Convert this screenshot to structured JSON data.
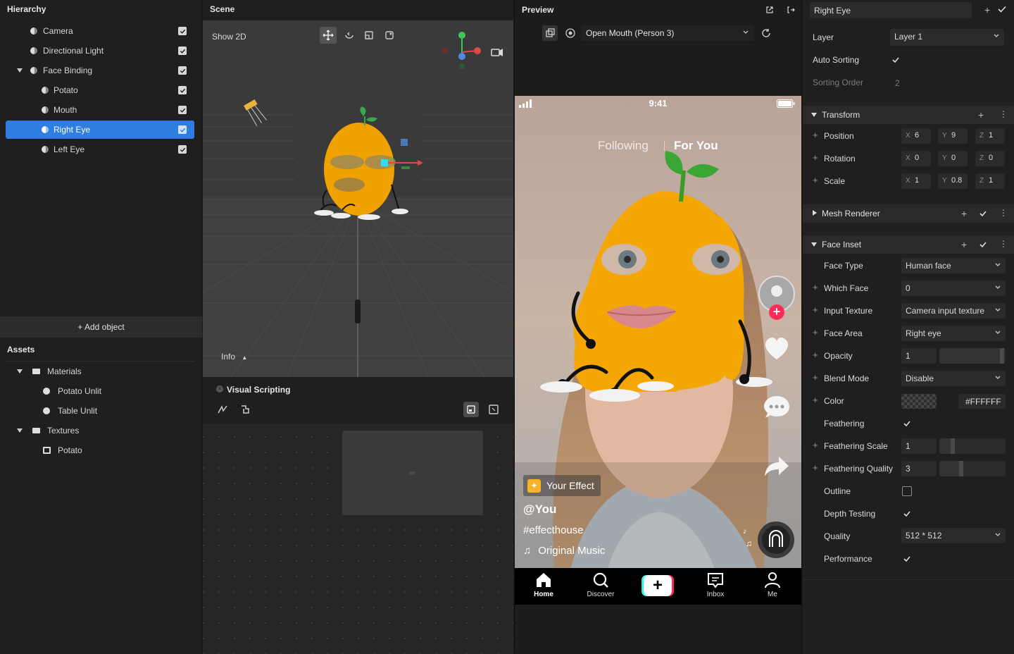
{
  "hierarchy": {
    "title": "Hierarchy",
    "items": [
      {
        "label": "Camera",
        "selected": false
      },
      {
        "label": "Directional Light",
        "selected": false
      },
      {
        "label": "Face Binding",
        "selected": false
      },
      {
        "label": "Potato",
        "selected": false
      },
      {
        "label": "Mouth",
        "selected": false
      },
      {
        "label": "Right Eye",
        "selected": true
      },
      {
        "label": "Left Eye",
        "selected": false
      }
    ],
    "add_object": "+ Add object"
  },
  "assets": {
    "title": "Assets",
    "items": [
      {
        "label": "Materials"
      },
      {
        "label": "Potato Unlit"
      },
      {
        "label": "Table Unlit"
      },
      {
        "label": "Textures"
      },
      {
        "label": "Potato"
      }
    ]
  },
  "scene": {
    "title": "Scene",
    "show2d": "Show 2D",
    "info": "Info"
  },
  "visual_scripting": {
    "title": "Visual Scripting"
  },
  "preview": {
    "title": "Preview",
    "trigger": "Open Mouth (Person 3)",
    "phone": {
      "time": "9:41",
      "following": "Following",
      "for_you": "For You",
      "effect_badge": "Your Effect",
      "user": "@You",
      "hashtag": "#effecthouse",
      "music": "Original Music",
      "nav": [
        "Home",
        "Discover",
        "Inbox",
        "Me"
      ]
    }
  },
  "inspector": {
    "object_name": "Right Eye",
    "layer_label": "Layer",
    "layer_value": "Layer 1",
    "auto_sorting": "Auto Sorting",
    "sorting_order": "Sorting Order",
    "sorting_order_value": "2",
    "transform": {
      "title": "Transform",
      "position": {
        "label": "Position",
        "x": "6",
        "y": "9",
        "z": "1"
      },
      "rotation": {
        "label": "Rotation",
        "x": "0",
        "y": "0",
        "z": "0"
      },
      "scale": {
        "label": "Scale",
        "x": "1",
        "y": "0.8",
        "z": "1"
      }
    },
    "mesh_renderer": "Mesh Renderer",
    "face_inset": {
      "title": "Face Inset",
      "face_type": {
        "label": "Face Type",
        "value": "Human face"
      },
      "which_face": {
        "label": "Which Face",
        "value": "0"
      },
      "input_texture": {
        "label": "Input Texture",
        "value": "Camera input texture"
      },
      "face_area": {
        "label": "Face Area",
        "value": "Right eye"
      },
      "opacity": {
        "label": "Opacity",
        "value": "1"
      },
      "blend_mode": {
        "label": "Blend Mode",
        "value": "Disable"
      },
      "color": {
        "label": "Color",
        "value": "#FFFFFF"
      },
      "feathering": "Feathering",
      "feathering_scale": {
        "label": "Feathering Scale",
        "value": "1"
      },
      "feathering_quality": {
        "label": "Feathering Quality",
        "value": "3"
      },
      "outline": "Outline",
      "depth_testing": "Depth Testing",
      "quality": {
        "label": "Quality",
        "value": "512 * 512"
      },
      "performance": "Performance"
    }
  },
  "colors": {
    "accent": "#2f7de1",
    "tiktok_red": "#fe2c55",
    "tiktok_cyan": "#25f4ee"
  }
}
